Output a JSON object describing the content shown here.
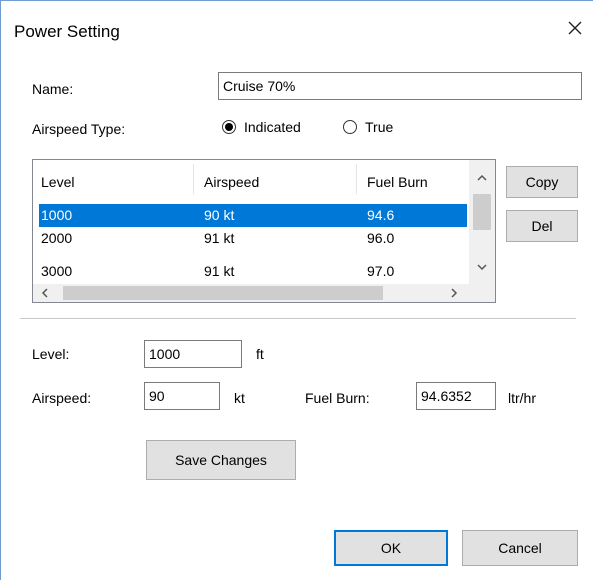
{
  "window": {
    "title": "Power Setting",
    "close_icon": "close-icon"
  },
  "name_field": {
    "label": "Name:",
    "value": "Cruise 70%"
  },
  "airspeed_type": {
    "label": "Airspeed Type:",
    "options": [
      {
        "label": "Indicated",
        "selected": true
      },
      {
        "label": "True",
        "selected": false
      }
    ]
  },
  "table": {
    "columns": [
      "Level",
      "Airspeed",
      "Fuel Burn"
    ],
    "rows": [
      {
        "level": "1000",
        "airspeed": "90 kt",
        "fuel_burn": "94.6",
        "selected": true
      },
      {
        "level": "2000",
        "airspeed": "91 kt",
        "fuel_burn": "96.0",
        "selected": false
      },
      {
        "level": "3000",
        "airspeed": "91 kt",
        "fuel_burn": "97.0",
        "selected": false
      }
    ],
    "scroll_up_icon": "chevron-up-icon",
    "scroll_down_icon": "chevron-down-icon",
    "scroll_left_icon": "chevron-left-icon",
    "scroll_right_icon": "chevron-right-icon"
  },
  "side_buttons": {
    "copy": "Copy",
    "del": "Del"
  },
  "edit": {
    "level": {
      "label": "Level:",
      "value": "1000",
      "unit": "ft"
    },
    "airspeed": {
      "label": "Airspeed:",
      "value": "90",
      "unit": "kt"
    },
    "fuel_burn": {
      "label": "Fuel Burn:",
      "value": "94.6352",
      "unit": "ltr/hr"
    }
  },
  "buttons": {
    "save": "Save Changes",
    "ok": "OK",
    "cancel": "Cancel"
  }
}
